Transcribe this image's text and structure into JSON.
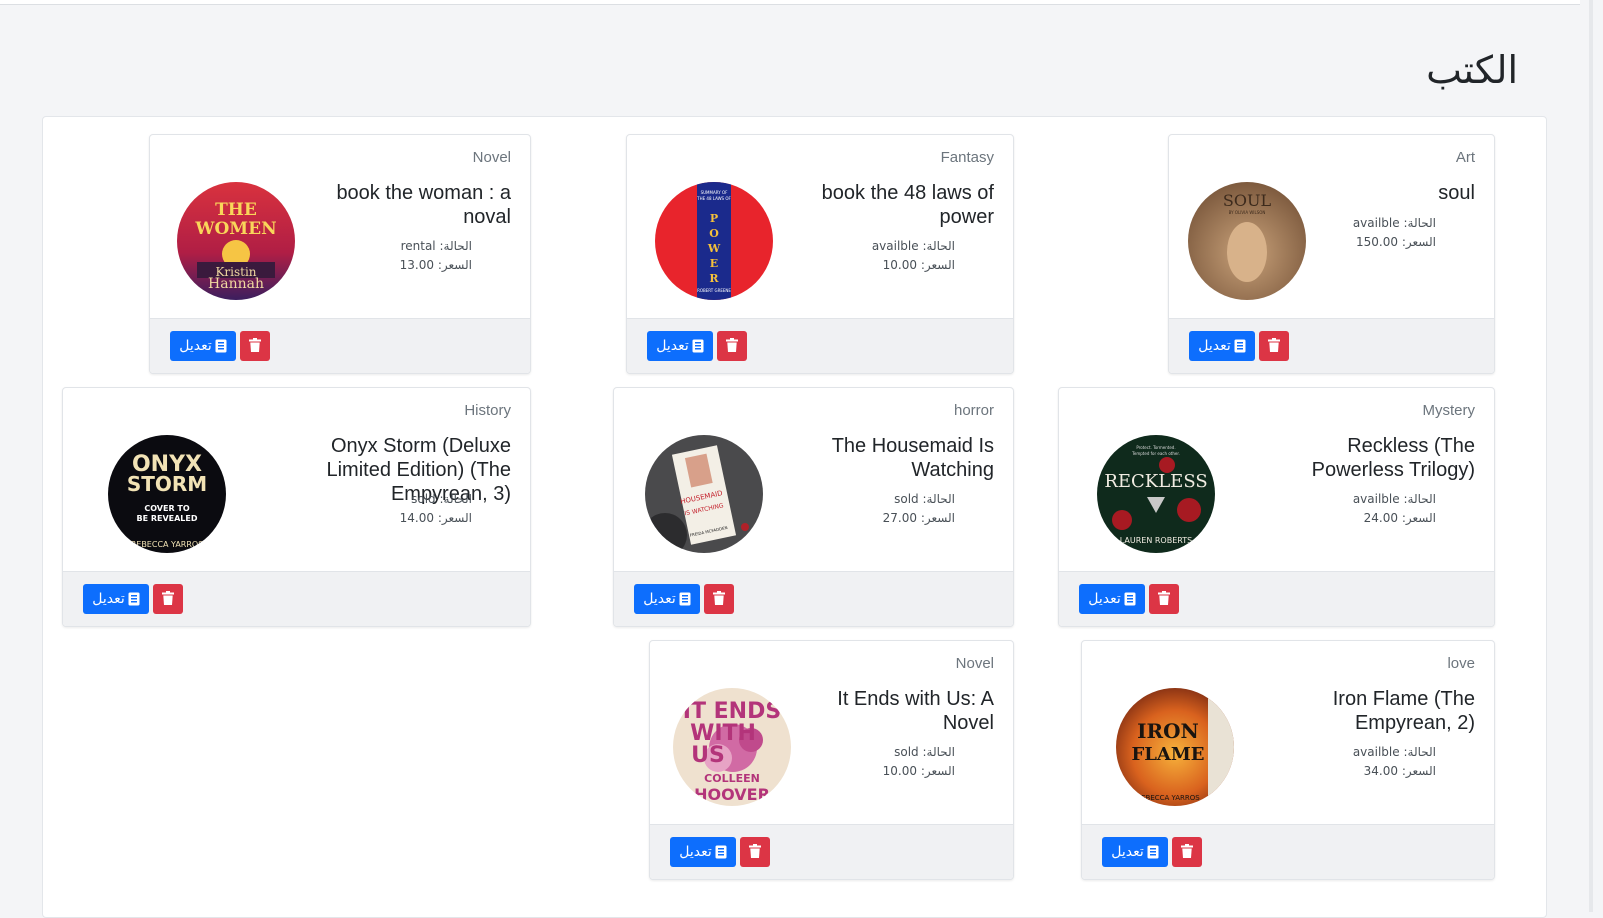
{
  "page": {
    "title": "الكتب"
  },
  "labels": {
    "status_label": "الحالة:",
    "price_label": "السعر:",
    "edit_label": "تعديل"
  },
  "colors": {
    "edit_button": "#0d6efd",
    "delete_button": "#dc3545"
  },
  "books": [
    {
      "category": "Novel",
      "title": "book the woman : a noval",
      "status": "rental",
      "price": "13.00",
      "cover": {
        "icon": "book-cover-the-women",
        "text_lines": [
          "THE",
          "WOMEN",
          "Kristin",
          "Hannah"
        ]
      }
    },
    {
      "category": "Fantasy",
      "title": "book the 48 laws of power",
      "status": "availble",
      "price": "10.00",
      "cover": {
        "icon": "book-cover-48-laws-of-power",
        "text_lines": [
          "SUMMARY OF",
          "THE 48 LAWS OF",
          "POWER",
          "ROBERT GREENE"
        ]
      }
    },
    {
      "category": "Art",
      "title": "soul",
      "status": "availble",
      "price": "150.00",
      "cover": {
        "icon": "book-cover-soul",
        "text_lines": [
          "SOUL",
          "BY OLIVIA WILSON"
        ]
      }
    },
    {
      "category": "History",
      "title": "Onyx Storm (Deluxe Limited Edition) (The Empyrean, 3)",
      "status": "sold",
      "price": "14.00",
      "cover": {
        "icon": "book-cover-onyx-storm",
        "text_lines": [
          "ONYX",
          "STORM",
          "COVER TO",
          "BE REVEALED",
          "REBECCA YARROS"
        ]
      }
    },
    {
      "category": "horror",
      "title": "The Housemaid Is Watching",
      "status": "sold",
      "price": "27.00",
      "cover": {
        "icon": "book-cover-housemaid",
        "text_lines": [
          "THE",
          "HOUSEMAID",
          "IS WATCHING",
          "FREIDA MCFADDEN"
        ]
      }
    },
    {
      "category": "Mystery",
      "title": "Reckless (The Powerless Trilogy)",
      "status": "availble",
      "price": "24.00",
      "cover": {
        "icon": "book-cover-reckless",
        "text_lines": [
          "Protect. Tormented.",
          "Tempted for each other.",
          "RECKLESS",
          "LAUREN ROBERTS"
        ]
      }
    },
    {
      "category": "Novel",
      "title": "It Ends with Us: A Novel",
      "status": "sold",
      "price": "10.00",
      "cover": {
        "icon": "book-cover-it-ends-with-us",
        "text_lines": [
          "IT ENDS",
          "WITH",
          "US",
          "COLLEEN",
          "HOOVER"
        ]
      }
    },
    {
      "category": "love",
      "title": "Iron Flame (The Empyrean, 2)",
      "status": "availble",
      "price": "34.00",
      "cover": {
        "icon": "book-cover-iron-flame",
        "text_lines": [
          "IRON",
          "FLAME",
          "REBECCA YARROS"
        ]
      }
    }
  ]
}
